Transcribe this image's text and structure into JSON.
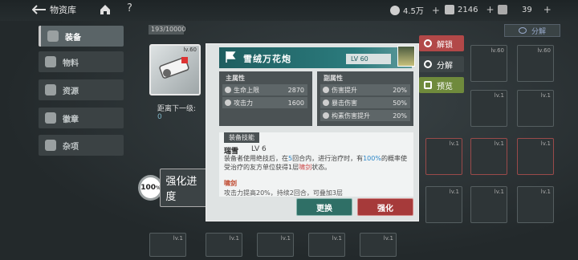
{
  "topbar": {
    "title": "物资库",
    "resources": [
      {
        "name": "coin",
        "value": "4.5万"
      },
      {
        "name": "gem",
        "value": "2146"
      },
      {
        "name": "ticket",
        "value": "39"
      }
    ]
  },
  "menu": {
    "items": [
      {
        "label": "装备",
        "active": true
      },
      {
        "label": "物料",
        "active": false
      },
      {
        "label": "资源",
        "active": false
      },
      {
        "label": "徽章",
        "active": false
      },
      {
        "label": "杂项",
        "active": false
      }
    ]
  },
  "capacity": "193/10000",
  "preview": {
    "level": "lv.60",
    "next_level_label": "距离下一级:",
    "next_level_value": "0",
    "boost_percent": "100",
    "boost_unit": "%",
    "boost_label": "强化进度"
  },
  "popup": {
    "name": "雪绒万花炮",
    "level": "LV 60",
    "main_title": "主属性",
    "main_stats": [
      {
        "label": "生命上限",
        "value": "2870"
      },
      {
        "label": "攻击力",
        "value": "1600"
      }
    ],
    "sub_title": "副属性",
    "sub_stats": [
      {
        "label": "伤害提升",
        "value": "20%"
      },
      {
        "label": "暴击伤害",
        "value": "50%"
      },
      {
        "label": "构素伤害提升",
        "value": "20%"
      }
    ],
    "skill_section": "装备技能",
    "skill_name": "瑞雪",
    "skill_level": "LV 6",
    "skill_desc_1": "装备者使用绝技后，在",
    "skill_desc_hl1": "5",
    "skill_desc_2": "回合内，进行治疗时，有",
    "skill_desc_hl2": "100%",
    "skill_desc_3": "的概率使受治疗的友方单位获得1层",
    "skill_desc_hl3": "啸剑",
    "skill_desc_4": "状态。",
    "skill2_name": "啸剑",
    "skill2_desc": "攻击力提高20%，持续2回合，可叠加3层",
    "swap_label": "更换",
    "upgrade_label": "强化"
  },
  "side": {
    "unlock_label": "解锁",
    "decompose_label": "分解",
    "preview_label": "预览",
    "top_decompose_label": "分解"
  },
  "slots": [
    {
      "level": "lv.60"
    },
    {
      "level": "lv.1"
    },
    {
      "level": "lv.1"
    },
    {
      "level": "lv.1"
    },
    {
      "level": "lv.1"
    },
    {
      "level": "lv.1"
    },
    {
      "level": "lv.1"
    },
    {
      "level": "lv.1"
    }
  ],
  "colors": {
    "accent_teal": "#2b7b7d",
    "upgrade_red": "#a63a3a",
    "swap_green": "#2f6f66",
    "highlight_blue": "#2c86c7"
  }
}
